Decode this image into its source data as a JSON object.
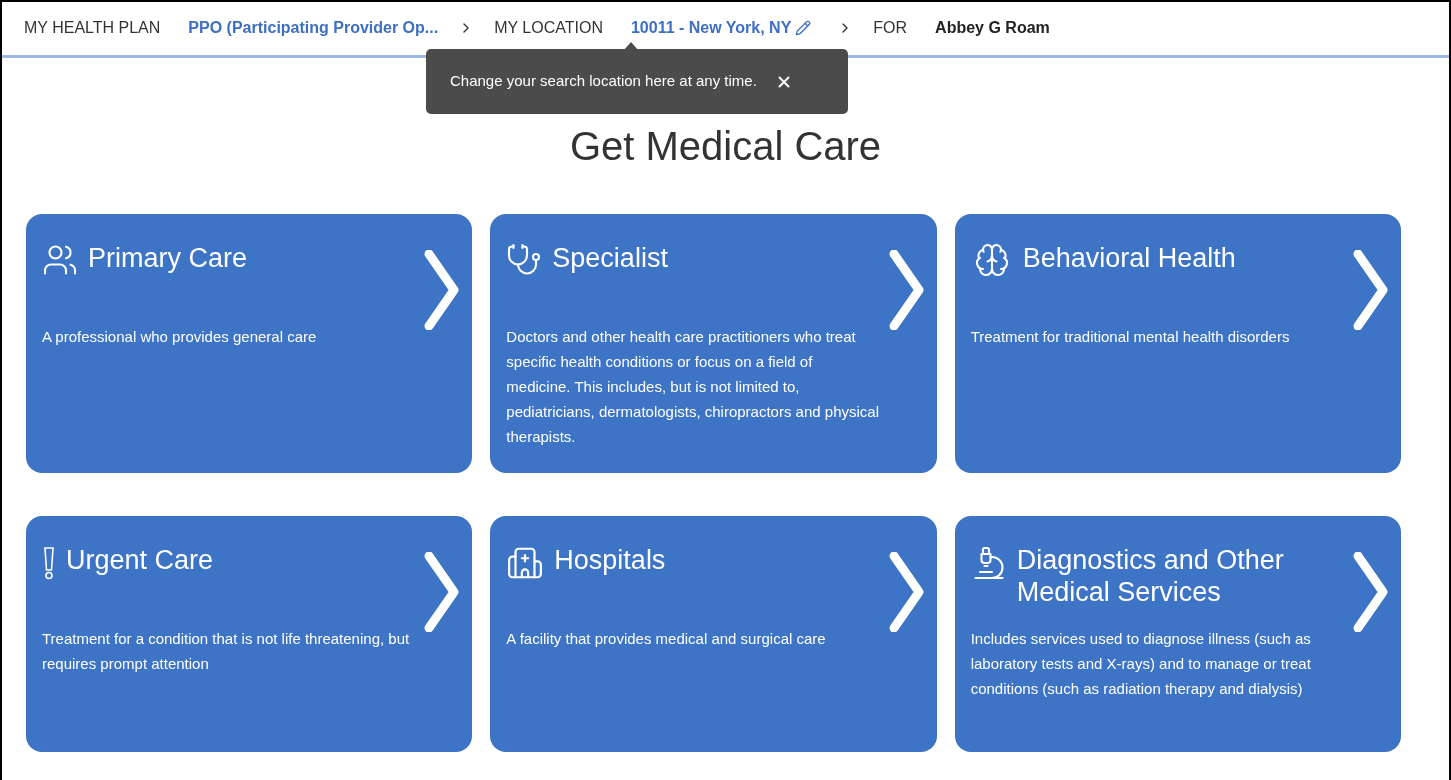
{
  "header": {
    "health_plan_label": "MY HEALTH PLAN",
    "health_plan": "PPO (Participating Provider Op...",
    "location_label": "MY LOCATION",
    "location": "10011 - New York, NY",
    "for_label": "FOR",
    "member": "Abbey G Roam"
  },
  "tooltip": {
    "text": "Change your search location here at any time."
  },
  "title": "Get Medical Care",
  "cards": [
    {
      "kind": "primary",
      "title": "Primary Care",
      "description": "A professional who provides general care"
    },
    {
      "kind": "specialist",
      "title": "Specialist",
      "description": "Doctors and other health care practitioners who treat specific health conditions or focus on a field of medicine. This includes, but is not limited to, pediatricians, dermatologists, chiropractors and physical therapists."
    },
    {
      "kind": "behavioral",
      "title": "Behavioral Health",
      "description": "Treatment for traditional mental health disorders"
    },
    {
      "kind": "urgent",
      "title": "Urgent Care",
      "description": "Treatment for a condition that is not life threatening, but requires prompt attention"
    },
    {
      "kind": "hospital",
      "title": "Hospitals",
      "description": "A facility that provides medical and surgical care"
    },
    {
      "kind": "diagnostics",
      "title": "Diagnostics and Other Medical Services",
      "description": "Includes services used to diagnose illness (such as laboratory tests and X-rays) and to manage or treat conditions (such as radiation therapy and dialysis)"
    }
  ]
}
